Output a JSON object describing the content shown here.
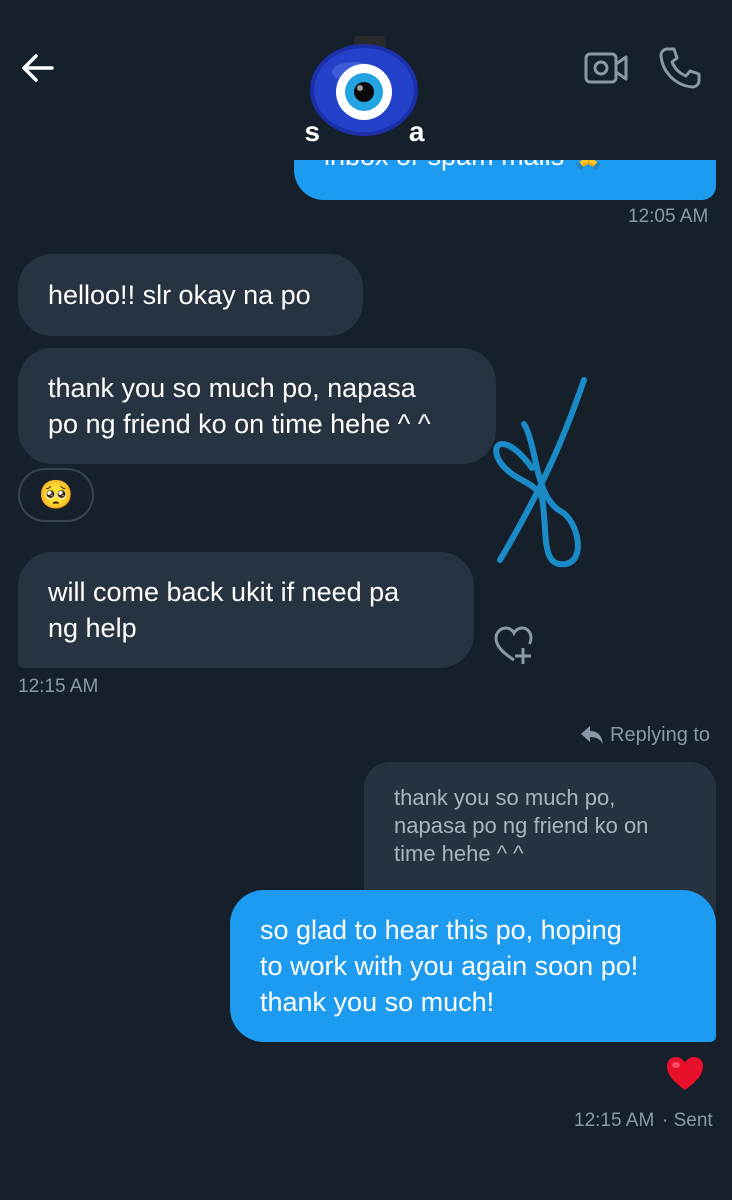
{
  "header": {
    "contact_name": "s          a",
    "icons": {
      "back": "back-arrow-icon",
      "video": "video-call-icon",
      "phone": "phone-call-icon",
      "avatar": "evil-eye-avatar"
    }
  },
  "messages": {
    "clipped_outgoing_text": "inbox or spam mails 🙏",
    "clipped_time": "12:05 AM",
    "incoming": [
      {
        "text": "helloo!! slr okay na po"
      },
      {
        "line1": "thank you so much po, napasa",
        "line2": "po ng friend ko on time hehe ^ ^"
      },
      {
        "line1": "will come back ukit if need pa",
        "line2": "ng help"
      }
    ],
    "incoming_reaction": "🥺",
    "incoming_time": "12:15 AM",
    "replying_label": "Replying to",
    "quoted": {
      "line1": "thank you so much po,",
      "line2": "napasa po ng friend ko on",
      "line3": "time hehe ^ ^"
    },
    "reply": {
      "line1": "so glad to hear this po, hoping",
      "line2": "to work with you again soon po!",
      "line3": "thank you so much!"
    },
    "reply_reaction": "❤️",
    "reply_time": "12:15 AM",
    "reply_status": "· Sent"
  },
  "colors": {
    "background": "#15202b",
    "incoming_bubble": "#273340",
    "outgoing_bubble": "#1d9bf0",
    "meta_text": "#8b98a5",
    "doodle": "#1a8bc7"
  }
}
